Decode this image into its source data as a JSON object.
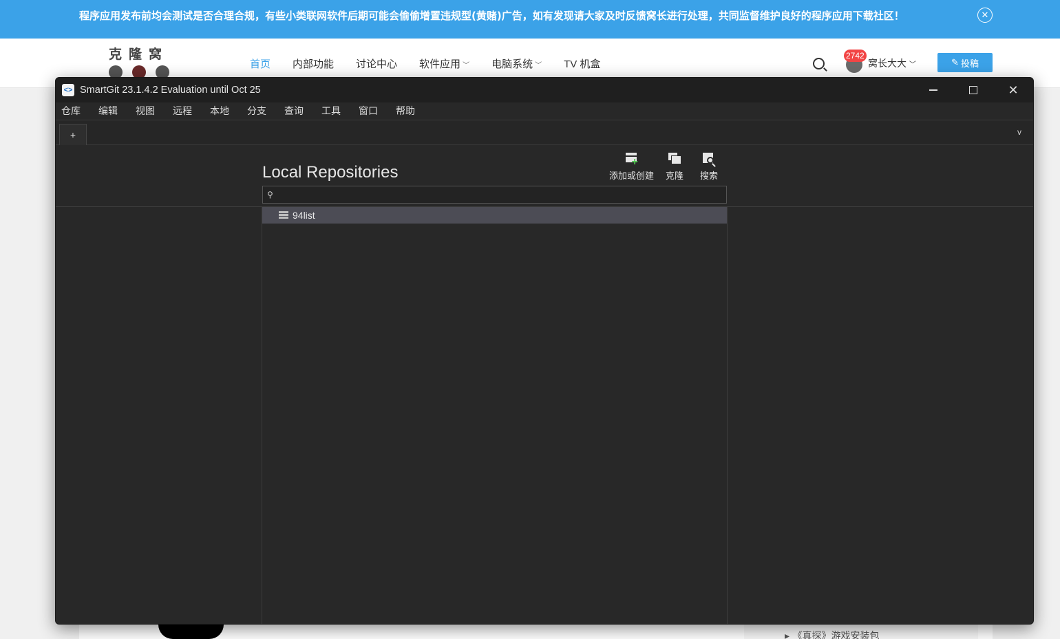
{
  "website": {
    "notice": "程序应用发布前均会测试是否合理合规，有些小类联网软件后期可能会偷偷增置违规型(黄赌)广告，如有发现请大家及时反馈窝长进行处理，共同监督维护良好的程序应用下载社区！",
    "logo_text": "克隆窝",
    "nav": [
      {
        "label": "首页",
        "active": true
      },
      {
        "label": "内部功能"
      },
      {
        "label": "讨论中心"
      },
      {
        "label": "软件应用",
        "has_dropdown": true
      },
      {
        "label": "电脑系统",
        "has_dropdown": true
      },
      {
        "label": "TV 机盒"
      }
    ],
    "user_badge": "2742",
    "user_name": "窝长大大",
    "submit_label": "投稿",
    "peek_text": "《真探》游戏安装包",
    "accent_color": "#3ba2e8"
  },
  "window": {
    "title": "SmartGit 23.1.4.2 Evaluation until Oct 25",
    "menu": [
      "仓库",
      "编辑",
      "视图",
      "远程",
      "本地",
      "分支",
      "查询",
      "工具",
      "窗口",
      "帮助"
    ],
    "tab_add_label": "+",
    "tab_dropdown_label": "v"
  },
  "repositories": {
    "title": "Local Repositories",
    "toolbar": {
      "add_label": "添加或创建",
      "clone_label": "克隆",
      "search_label": "搜索"
    },
    "filter_value": "",
    "items": [
      {
        "name": "94list",
        "selected": true
      }
    ]
  }
}
